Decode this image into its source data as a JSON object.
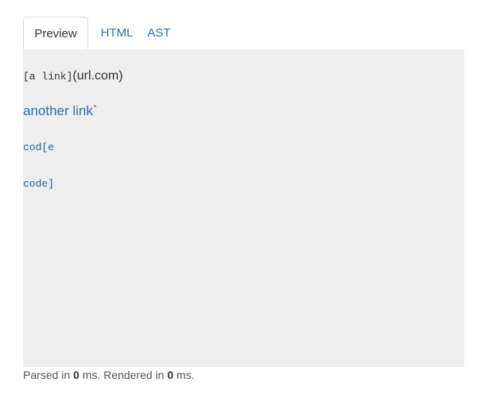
{
  "tabs": [
    {
      "label": "Preview",
      "active": true
    },
    {
      "label": "HTML",
      "active": false
    },
    {
      "label": "AST",
      "active": false
    }
  ],
  "preview": {
    "line1_code": "[a link]",
    "line1_text": "(url.com)",
    "line2_link": "another link",
    "line2_tick": "`",
    "line3_code": "cod[e",
    "line4_code": "code]"
  },
  "status": {
    "parsed_prefix": "Parsed in ",
    "parsed_value": "0",
    "parsed_suffix": " ms. Rendered in ",
    "rendered_value": "0",
    "rendered_suffix": " ms."
  },
  "colors": {
    "link": "#2a6ebb",
    "pane_bg": "#eeeeee",
    "text": "#333333"
  }
}
